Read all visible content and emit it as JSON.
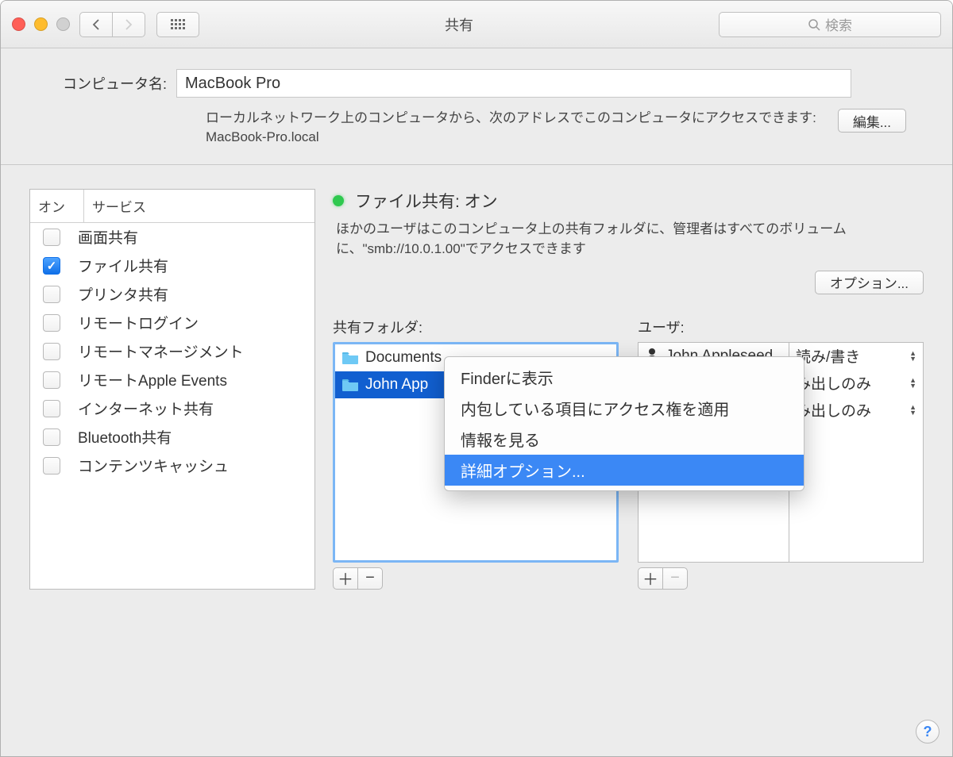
{
  "window": {
    "title": "共有"
  },
  "search": {
    "placeholder": "検索"
  },
  "compname": {
    "label": "コンピュータ名:",
    "value": "MacBook Pro",
    "desc": "ローカルネットワーク上のコンピュータから、次のアドレスでこのコンピュータにアクセスできます: MacBook-Pro.local",
    "edit_btn": "編集..."
  },
  "services": {
    "head_on": "オン",
    "head_service": "サービス",
    "items": [
      {
        "label": "画面共有",
        "on": false
      },
      {
        "label": "ファイル共有",
        "on": true
      },
      {
        "label": "プリンタ共有",
        "on": false
      },
      {
        "label": "リモートログイン",
        "on": false
      },
      {
        "label": "リモートマネージメント",
        "on": false
      },
      {
        "label": "リモートApple Events",
        "on": false
      },
      {
        "label": "インターネット共有",
        "on": false
      },
      {
        "label": "Bluetooth共有",
        "on": false
      },
      {
        "label": "コンテンツキャッシュ",
        "on": false
      }
    ]
  },
  "status": {
    "title": "ファイル共有: オン",
    "desc": "ほかのユーザはこのコンピュータ上の共有フォルダに、管理者はすべてのボリュームに、\"smb://10.0.1.00\"でアクセスできます",
    "options_btn": "オプション..."
  },
  "folders": {
    "label": "共有フォルダ:",
    "items": [
      {
        "name": "Documents"
      },
      {
        "name": "John App"
      }
    ]
  },
  "users": {
    "label": "ユーザ:",
    "items": [
      {
        "name": "John Appleseed",
        "perm": "読み/書き"
      },
      {
        "name": "",
        "perm": "み出しのみ"
      },
      {
        "name": "",
        "perm": "み出しのみ"
      }
    ]
  },
  "context_menu": {
    "items": [
      "Finderに表示",
      "内包している項目にアクセス権を適用",
      "情報を見る",
      "詳細オプション..."
    ],
    "highlighted": 3
  }
}
